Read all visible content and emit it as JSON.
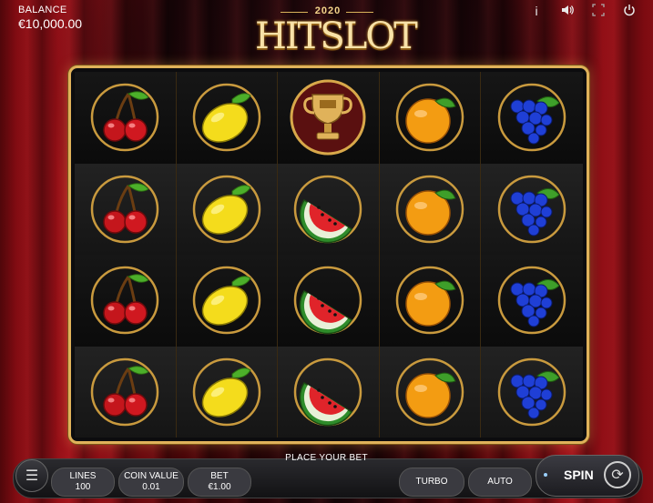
{
  "header": {
    "balance_label": "BALANCE",
    "balance_value": "€10,000.00",
    "logo_year": "2020",
    "logo_title": "HITSLOT",
    "icons": [
      "info-icon",
      "sound-icon",
      "fullscreen-icon",
      "power-icon"
    ]
  },
  "reels": {
    "columns": [
      [
        "cherry",
        "cherry",
        "cherry",
        "cherry"
      ],
      [
        "lemon",
        "lemon",
        "lemon",
        "lemon"
      ],
      [
        "trophy",
        "watermelon",
        "watermelon",
        "watermelon"
      ],
      [
        "orange",
        "orange",
        "orange",
        "orange"
      ],
      [
        "grapes",
        "grapes",
        "grapes",
        "grapes"
      ]
    ]
  },
  "controls": {
    "message": "PLACE YOUR BET",
    "lines_label": "LINES",
    "lines_value": "100",
    "coin_label": "COIN VALUE",
    "coin_value": "0.01",
    "bet_label": "BET",
    "bet_value": "€1.00",
    "turbo_label": "TURBO",
    "auto_label": "AUTO",
    "spin_label": "SPIN"
  },
  "colors": {
    "frame_gold": "#e0b25a",
    "curtain_red": "#a0121a",
    "panel_dark": "#2a2a2e"
  }
}
